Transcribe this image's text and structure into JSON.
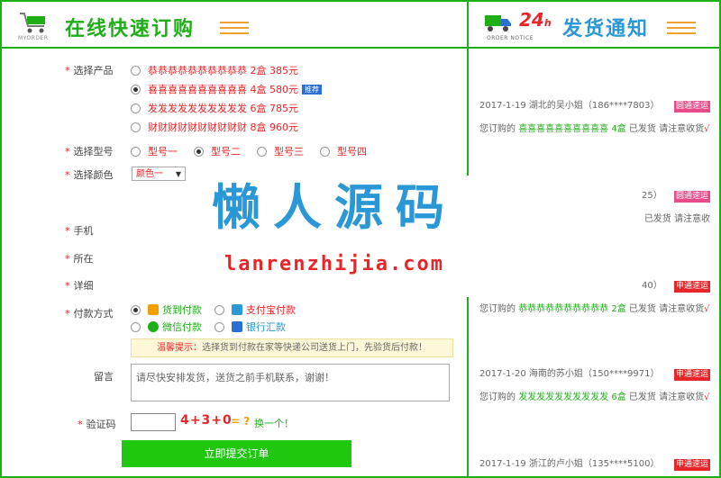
{
  "header": {
    "left_title": "在线快速订购",
    "left_sub": "MYORDER",
    "right_title": "发货通知",
    "right_sub": "ORDER NOTICE",
    "right_badge_num": "24",
    "right_badge_h": "h"
  },
  "form": {
    "product_label": "选择产品",
    "products": [
      {
        "text": "恭恭恭恭恭恭恭恭恭恭 2盒 385元",
        "checked": false
      },
      {
        "text": "喜喜喜喜喜喜喜喜喜喜 4盒 580元",
        "checked": true,
        "badge": "推荐"
      },
      {
        "text": "发发发发发发发发发发 6盒 785元",
        "checked": false
      },
      {
        "text": "财财财财财财财财财财 8盒 960元",
        "checked": false
      }
    ],
    "model_label": "选择型号",
    "models": [
      {
        "text": "型号一",
        "checked": false
      },
      {
        "text": "型号二",
        "checked": true
      },
      {
        "text": "型号三",
        "checked": false
      },
      {
        "text": "型号四",
        "checked": false
      }
    ],
    "color_label": "选择颜色",
    "color_value": "颜色一",
    "phone_label": "手机",
    "region_label": "所在",
    "address_label": "详细",
    "pay_label": "付款方式",
    "pay_options": [
      {
        "text": "货到付款",
        "checked": true,
        "color": "#1fae18"
      },
      {
        "text": "支付宝付款",
        "checked": false,
        "color": "#e8262a"
      },
      {
        "text": "微信付款",
        "checked": false,
        "color": "#1fae18"
      },
      {
        "text": "银行汇款",
        "checked": false,
        "color": "#2a97d6"
      }
    ],
    "tip_title": "温馨提示：",
    "tip_text": "选择货到付款在家等快递公司送货上门，先验货后付款！",
    "message_label": "留言",
    "message_placeholder": "请尽快安排发货，送货之前手机联系，谢谢！",
    "captcha_label": "验证码",
    "captcha_expr": "4+3+0",
    "captcha_eq": "= ?",
    "captcha_change": "换一个！",
    "submit_label": "立即提交订单"
  },
  "notices": [
    {
      "header": "2017-1-19 湖北的吴小姐（186****7803）",
      "tag": "圆通速运",
      "pre": "您订购的 ",
      "product": "喜喜喜喜喜喜喜喜喜喜 4盒",
      "post": " 已发货 请注意收货",
      "mark": "√"
    },
    {
      "header": "25）",
      "tag": "圆通速运",
      "pre": "",
      "product": "",
      "post": "已发货 请注意收",
      "mark": ""
    },
    {
      "header": "40）",
      "tag": "申通速运",
      "pre": "您订购的 ",
      "product": "恭恭恭恭恭恭恭恭恭恭 2盒",
      "post": " 已发货 请注意收货",
      "mark": "√"
    },
    {
      "header": "2017-1-20 海南的苏小姐（150****9971）",
      "tag": "申通速运",
      "pre": "您订购的 ",
      "product": "发发发发发发发发发发 6盒",
      "post": " 已发货 请注意收货",
      "mark": "√"
    },
    {
      "header": "2017-1-19 浙江的卢小姐（135****5100）",
      "tag": "申通速运",
      "pre": "",
      "product": "",
      "post": "",
      "mark": ""
    }
  ],
  "watermark": {
    "title": "懒人源码",
    "domain": "lanrenzhijia.com"
  }
}
